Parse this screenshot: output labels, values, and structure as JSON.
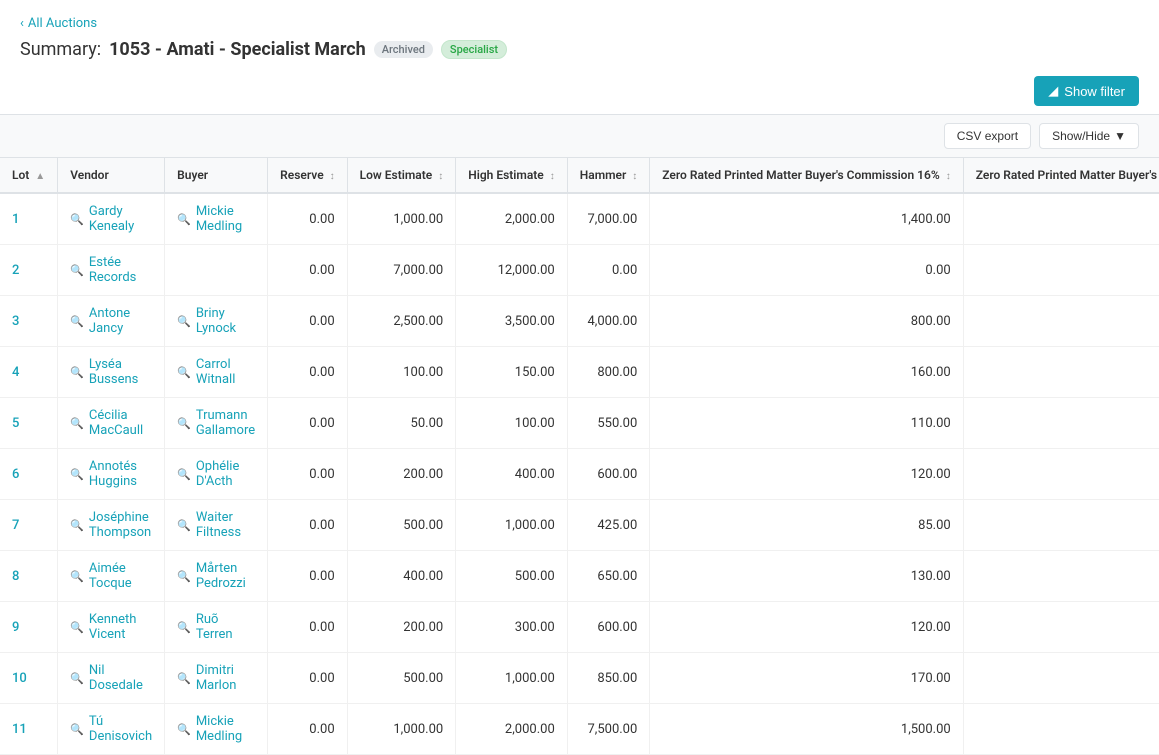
{
  "nav": {
    "back_label": "All Auctions"
  },
  "header": {
    "title_prefix": "Summary:",
    "title_main": "1053 - Amati - Specialist March",
    "badge_archived": "Archived",
    "badge_specialist": "Specialist"
  },
  "toolbar": {
    "show_filter_label": "Show filter",
    "csv_export_label": "CSV export",
    "show_hide_label": "Show/Hide"
  },
  "table": {
    "columns": [
      {
        "id": "lot",
        "label": "Lot",
        "sortable": true
      },
      {
        "id": "vendor",
        "label": "Vendor",
        "sortable": false
      },
      {
        "id": "buyer",
        "label": "Buyer",
        "sortable": false
      },
      {
        "id": "reserve",
        "label": "Reserve",
        "sortable": true
      },
      {
        "id": "low_estimate",
        "label": "Low Estimate",
        "sortable": true
      },
      {
        "id": "high_estimate",
        "label": "High Estimate",
        "sortable": true
      },
      {
        "id": "hammer",
        "label": "Hammer",
        "sortable": true
      },
      {
        "id": "zrpm16",
        "label": "Zero Rated Printed Matter Buyer's Commission 16%",
        "sortable": true
      },
      {
        "id": "zrpm2",
        "label": "Zero Rated Printed Matter Buyer's Commi...",
        "sortable": false
      }
    ],
    "rows": [
      {
        "lot": "1",
        "vendor": "Gardy Kenealy",
        "buyer": "Mickie Medling",
        "reserve": "0.00",
        "low_estimate": "1,000.00",
        "high_estimate": "2,000.00",
        "hammer": "7,000.00",
        "zrpm16": "1,400.00",
        "zrpm2": ""
      },
      {
        "lot": "2",
        "vendor": "Estée Records",
        "buyer": "",
        "reserve": "0.00",
        "low_estimate": "7,000.00",
        "high_estimate": "12,000.00",
        "hammer": "0.00",
        "zrpm16": "0.00",
        "zrpm2": ""
      },
      {
        "lot": "3",
        "vendor": "Antone Jancy",
        "buyer": "Briny Lynock",
        "reserve": "0.00",
        "low_estimate": "2,500.00",
        "high_estimate": "3,500.00",
        "hammer": "4,000.00",
        "zrpm16": "800.00",
        "zrpm2": ""
      },
      {
        "lot": "4",
        "vendor": "Lyséa Bussens",
        "buyer": "Carrol Witnall",
        "reserve": "0.00",
        "low_estimate": "100.00",
        "high_estimate": "150.00",
        "hammer": "800.00",
        "zrpm16": "160.00",
        "zrpm2": ""
      },
      {
        "lot": "5",
        "vendor": "Cécilia MacCaull",
        "buyer": "Trumann Gallamore",
        "reserve": "0.00",
        "low_estimate": "50.00",
        "high_estimate": "100.00",
        "hammer": "550.00",
        "zrpm16": "110.00",
        "zrpm2": ""
      },
      {
        "lot": "6",
        "vendor": "Annotés Huggins",
        "buyer": "Ophélie D'Acth",
        "reserve": "0.00",
        "low_estimate": "200.00",
        "high_estimate": "400.00",
        "hammer": "600.00",
        "zrpm16": "120.00",
        "zrpm2": ""
      },
      {
        "lot": "7",
        "vendor": "Joséphine Thompson",
        "buyer": "Waiter Filtness",
        "reserve": "0.00",
        "low_estimate": "500.00",
        "high_estimate": "1,000.00",
        "hammer": "425.00",
        "zrpm16": "85.00",
        "zrpm2": ""
      },
      {
        "lot": "8",
        "vendor": "Aimée Tocque",
        "buyer": "Mårten Pedrozzi",
        "reserve": "0.00",
        "low_estimate": "400.00",
        "high_estimate": "500.00",
        "hammer": "650.00",
        "zrpm16": "130.00",
        "zrpm2": ""
      },
      {
        "lot": "9",
        "vendor": "Kenneth Vicent",
        "buyer": "Ruõ Terren",
        "reserve": "0.00",
        "low_estimate": "200.00",
        "high_estimate": "300.00",
        "hammer": "600.00",
        "zrpm16": "120.00",
        "zrpm2": ""
      },
      {
        "lot": "10",
        "vendor": "Nil Dosedale",
        "buyer": "Dimitri Marlon",
        "reserve": "0.00",
        "low_estimate": "500.00",
        "high_estimate": "1,000.00",
        "hammer": "850.00",
        "zrpm16": "170.00",
        "zrpm2": ""
      },
      {
        "lot": "11",
        "vendor": "Tú Denisovich",
        "buyer": "Mickie Medling",
        "reserve": "0.00",
        "low_estimate": "1,000.00",
        "high_estimate": "2,000.00",
        "hammer": "7,500.00",
        "zrpm16": "1,500.00",
        "zrpm2": ""
      }
    ]
  }
}
